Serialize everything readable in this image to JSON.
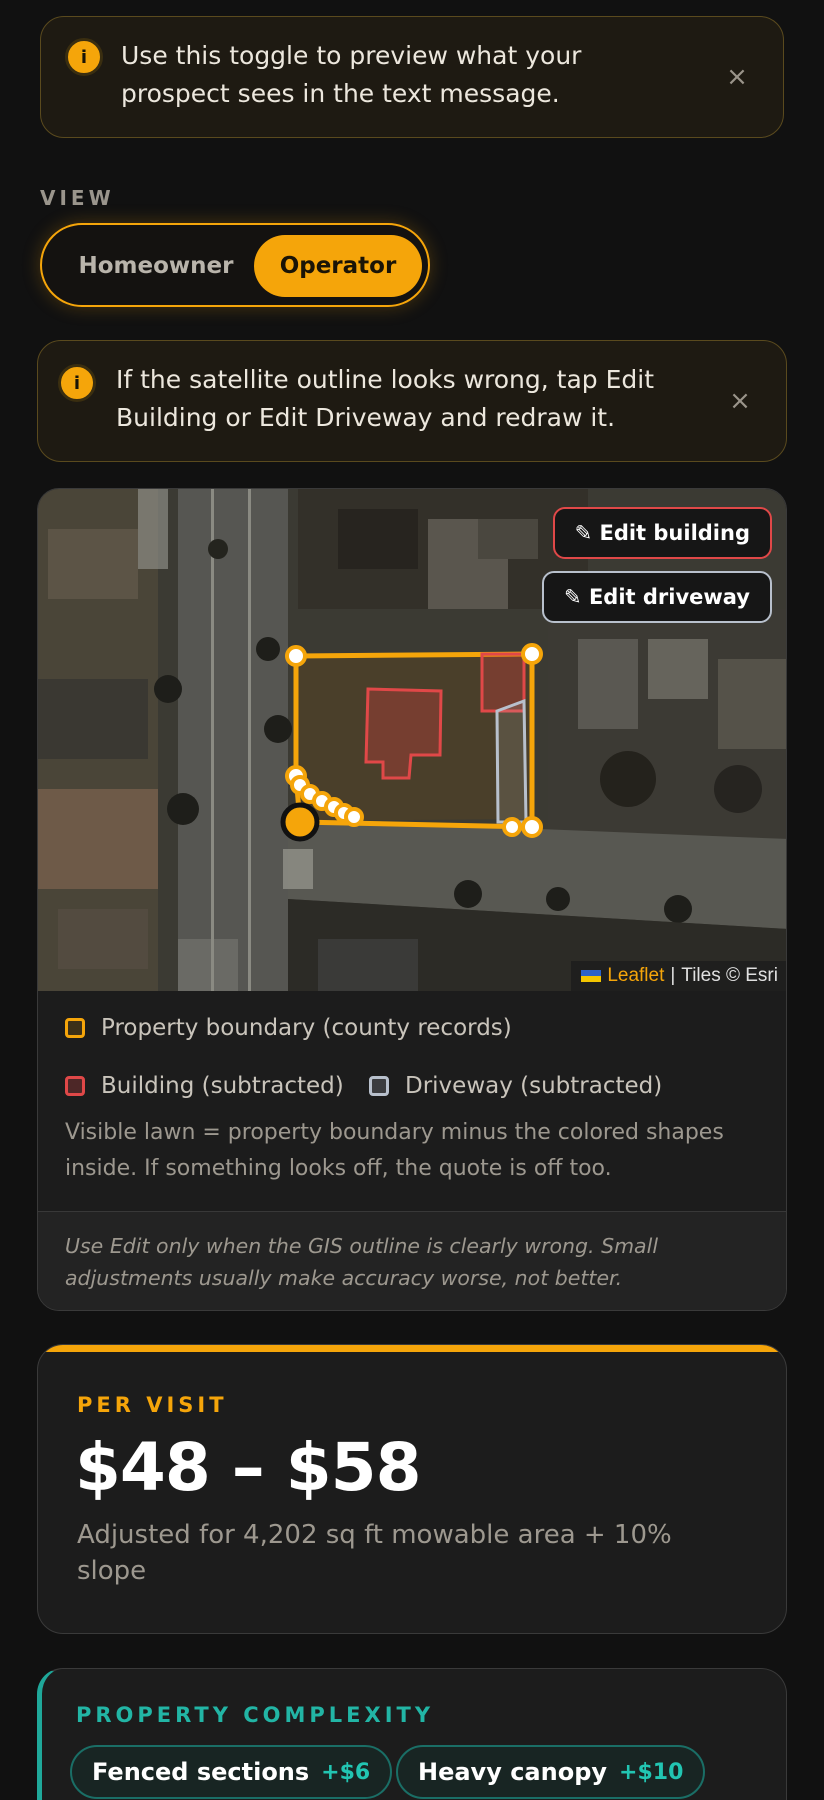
{
  "banners": {
    "toggle_hint": "Use this toggle to preview what your prospect sees in the text message.",
    "outline_hint": "If the satellite outline looks wrong, tap Edit Building or Edit Driveway and redraw it.",
    "info_glyph": "i",
    "close_glyph": "×"
  },
  "view": {
    "label": "VIEW",
    "options": [
      "Homeowner",
      "Operator"
    ],
    "selected": "Operator"
  },
  "map": {
    "edit_building_label": "✎ Edit building",
    "edit_driveway_label": "✎ Edit driveway",
    "attribution": {
      "leaflet": "Leaflet",
      "separator": "|",
      "tiles": "Tiles © Esri"
    },
    "colors": {
      "boundary": "#f5a50a",
      "building": "#e04848",
      "driveway": "#b8c0cc"
    }
  },
  "legend": {
    "boundary": "Property boundary (county records)",
    "building": "Building (subtracted)",
    "driveway": "Driveway (subtracted)",
    "note": "Visible lawn = property boundary minus the colored shapes inside. If something looks off, the quote is off too.",
    "hint": "Use Edit only when the GIS outline is clearly wrong. Small adjustments usually make accuracy worse, not better."
  },
  "pricing": {
    "label": "PER VISIT",
    "range": "$48 – $58",
    "note": "Adjusted for 4,202 sq ft mowable area + 10% slope",
    "accent": "#f5a50a"
  },
  "complexity": {
    "label": "PROPERTY COMPLEXITY",
    "chips": [
      {
        "name": "Fenced sections",
        "amount": "+$6"
      },
      {
        "name": "Heavy canopy",
        "amount": "+$10"
      }
    ],
    "accent": "#1fa89a"
  }
}
